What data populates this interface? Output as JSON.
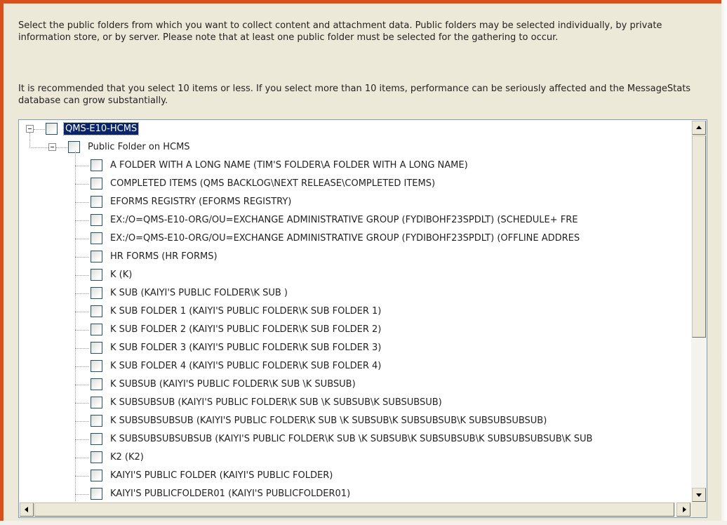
{
  "instructions": {
    "paragraph_1": "Select the public folders from which you want to collect content and attachment data. Public folders may be selected individually, by private information store, or by server. Please note that at least one public folder must be selected for the gathering to occur.",
    "paragraph_2": "It is recommended that you select 10 items or less. If you select more than 10 items, performance can be seriously affected and the MessageStats database can grow substantially."
  },
  "tree": {
    "server": {
      "label": "QMS-E10-HCMS",
      "selected": true,
      "checked": false
    },
    "store": {
      "label": "Public Folder on HCMS",
      "checked": false
    },
    "folders": [
      {
        "label": "A FOLDER WITH A LONG NAME (TIM'S FOLDER\\A FOLDER WITH A LONG NAME)",
        "checked": false
      },
      {
        "label": "COMPLETED ITEMS (QMS BACKLOG\\NEXT RELEASE\\COMPLETED ITEMS)",
        "checked": false
      },
      {
        "label": "EFORMS REGISTRY (EFORMS REGISTRY)",
        "checked": false
      },
      {
        "label": "EX:/O=QMS-E10-ORG/OU=EXCHANGE ADMINISTRATIVE GROUP (FYDIBOHF23SPDLT) (SCHEDULE+ FRE",
        "checked": false
      },
      {
        "label": "EX:/O=QMS-E10-ORG/OU=EXCHANGE ADMINISTRATIVE GROUP (FYDIBOHF23SPDLT) (OFFLINE ADDRES",
        "checked": false
      },
      {
        "label": "HR FORMS (HR FORMS)",
        "checked": false
      },
      {
        "label": "K (K)",
        "checked": false
      },
      {
        "label": "K SUB  (KAIYI'S PUBLIC FOLDER\\K SUB )",
        "checked": false
      },
      {
        "label": "K SUB FOLDER 1 (KAIYI'S PUBLIC FOLDER\\K SUB FOLDER 1)",
        "checked": false
      },
      {
        "label": "K SUB FOLDER 2 (KAIYI'S PUBLIC FOLDER\\K SUB FOLDER 2)",
        "checked": false
      },
      {
        "label": "K SUB FOLDER 3 (KAIYI'S PUBLIC FOLDER\\K SUB FOLDER 3)",
        "checked": false
      },
      {
        "label": "K SUB FOLDER 4 (KAIYI'S PUBLIC FOLDER\\K SUB FOLDER 4)",
        "checked": false
      },
      {
        "label": "K SUBSUB (KAIYI'S PUBLIC FOLDER\\K SUB \\K SUBSUB)",
        "checked": false
      },
      {
        "label": "K SUBSUBSUB (KAIYI'S PUBLIC FOLDER\\K SUB \\K SUBSUB\\K SUBSUBSUB)",
        "checked": false
      },
      {
        "label": "K SUBSUBSUBSUB (KAIYI'S PUBLIC FOLDER\\K SUB \\K SUBSUB\\K SUBSUBSUB\\K SUBSUBSUBSUB)",
        "checked": false
      },
      {
        "label": "K SUBSUBSUBSUBSUB (KAIYI'S PUBLIC FOLDER\\K SUB \\K SUBSUB\\K SUBSUBSUB\\K SUBSUBSUBSUB\\K SUB",
        "checked": false
      },
      {
        "label": "K2 (K2)",
        "checked": false
      },
      {
        "label": "KAIYI'S PUBLIC FOLDER (KAIYI'S PUBLIC FOLDER)",
        "checked": false
      },
      {
        "label": "KAIYI'S PUBLICFOLDER01 (KAIYI'S PUBLICFOLDER01)",
        "checked": false
      }
    ]
  },
  "colors": {
    "frame_accent": "#d8501c",
    "dialog_background": "#ece9d8",
    "selection_background": "#0a246a",
    "tree_background": "#ffffff"
  }
}
